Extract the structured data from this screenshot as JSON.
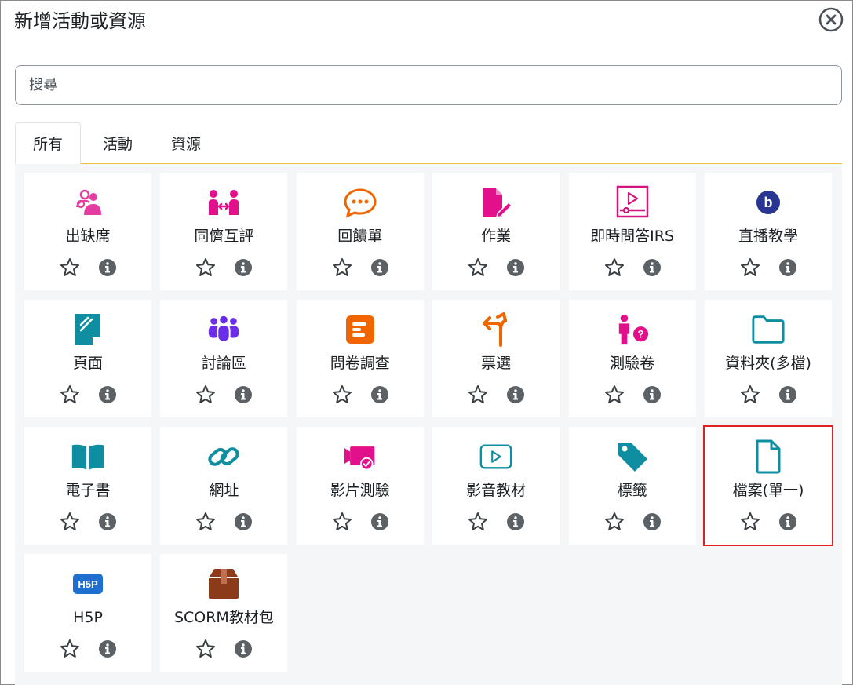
{
  "modal": {
    "title": "新增活動或資源",
    "close_icon": "close-circle-icon"
  },
  "search": {
    "placeholder": "搜尋",
    "value": ""
  },
  "tabs": [
    {
      "label": "所有",
      "active": true
    },
    {
      "label": "活動",
      "active": false
    },
    {
      "label": "資源",
      "active": false
    }
  ],
  "modules": [
    {
      "label": "出缺席",
      "icon": "attendance-icon",
      "color": "#e43ca0"
    },
    {
      "label": "同儕互評",
      "icon": "peer-review-icon",
      "color": "#e2108a"
    },
    {
      "label": "回饋單",
      "icon": "feedback-icon",
      "color": "#f06500"
    },
    {
      "label": "作業",
      "icon": "assignment-icon",
      "color": "#e2108a"
    },
    {
      "label": "即時問答IRS",
      "icon": "irs-video-icon",
      "color": "#d3167f"
    },
    {
      "label": "直播教學",
      "icon": "bigbluebutton-icon",
      "color": "#283593"
    },
    {
      "label": "頁面",
      "icon": "page-icon",
      "color": "#0f8ea1"
    },
    {
      "label": "討論區",
      "icon": "forum-icon",
      "color": "#6a2ee8"
    },
    {
      "label": "問卷調查",
      "icon": "survey-icon",
      "color": "#f06500"
    },
    {
      "label": "票選",
      "icon": "choice-icon",
      "color": "#f06500"
    },
    {
      "label": "測驗卷",
      "icon": "quiz-icon",
      "color": "#e2108a"
    },
    {
      "label": "資料夾(多檔)",
      "icon": "folder-icon",
      "color": "#0f8ea1"
    },
    {
      "label": "電子書",
      "icon": "book-icon",
      "color": "#0f8ea1"
    },
    {
      "label": "網址",
      "icon": "link-icon",
      "color": "#0f8ea1"
    },
    {
      "label": "影片測驗",
      "icon": "video-quiz-icon",
      "color": "#e2108a"
    },
    {
      "label": "影音教材",
      "icon": "video-player-icon",
      "color": "#0f8ea1"
    },
    {
      "label": "標籤",
      "icon": "tag-icon",
      "color": "#0f8ea1"
    },
    {
      "label": "檔案(單一)",
      "icon": "file-icon",
      "color": "#0f8ea1"
    },
    {
      "label": "H5P",
      "icon": "h5p-icon",
      "color": "#1f6fd1"
    },
    {
      "label": "SCORM教材包",
      "icon": "scorm-package-icon",
      "color": "#8b3a1a"
    }
  ],
  "highlighted_module": "檔案(單一)",
  "actions": {
    "star_icon": "star-icon",
    "info_icon": "info-icon"
  },
  "colors": {
    "tab_underline": "#f0c040",
    "highlight_border": "#e02020",
    "grid_background": "#f5f6f7"
  }
}
